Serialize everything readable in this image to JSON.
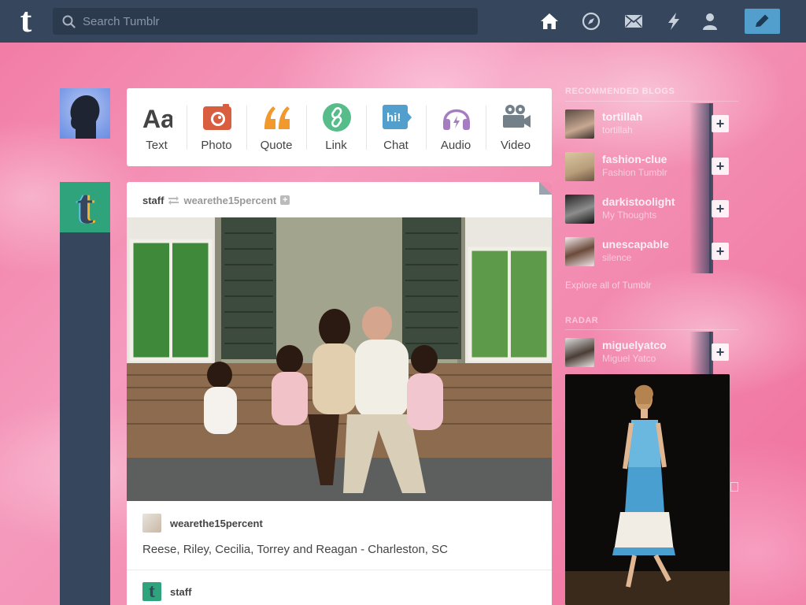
{
  "header": {
    "search_placeholder": "Search Tumblr",
    "nav_icons": [
      "home-icon",
      "explore-compass-icon",
      "inbox-mail-icon",
      "activity-lightning-icon",
      "account-person-icon"
    ],
    "compose_icon": "pencil-icon"
  },
  "post_types": [
    {
      "label": "Text",
      "icon": "text-aa-icon",
      "color": "#444444"
    },
    {
      "label": "Photo",
      "icon": "camera-icon",
      "color": "#d95e40"
    },
    {
      "label": "Quote",
      "icon": "quote-icon",
      "color": "#f2992e"
    },
    {
      "label": "Link",
      "icon": "link-icon",
      "color": "#56bc8a"
    },
    {
      "label": "Chat",
      "icon": "chat-icon",
      "color": "#529ecc"
    },
    {
      "label": "Audio",
      "icon": "headphones-icon",
      "color": "#a77dc2"
    },
    {
      "label": "Video",
      "icon": "video-camera-icon",
      "color": "#748089"
    }
  ],
  "post": {
    "author": "staff",
    "reblogged_from": "wearethe15percent",
    "caption_user": "wearethe15percent",
    "caption": "Reese, Riley, Cecilia, Torrey and Reagan - Charleston, SC",
    "footer_user": "staff"
  },
  "sidebar": {
    "recommended_heading": "RECOMMENDED BLOGS",
    "blogs": [
      {
        "name": "tortillah",
        "title": "tortillah"
      },
      {
        "name": "fashion-clue",
        "title": "Fashion Tumblr"
      },
      {
        "name": "darkistoolight",
        "title": "My Thoughts"
      },
      {
        "name": "unescapable",
        "title": "silence"
      }
    ],
    "explore_link": "Explore all of Tumblr",
    "radar_heading": "RADAR",
    "radar_blog": {
      "name": "miguelyatco",
      "title": "Miguel Yatco"
    }
  },
  "colors": {
    "header_bg": "#36465d",
    "accent_blue": "#529ecc",
    "background_pink": "#f38cb1"
  }
}
